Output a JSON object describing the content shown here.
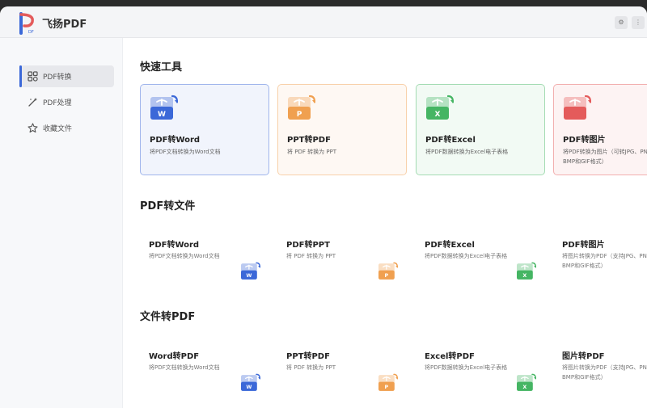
{
  "app": {
    "title": "飞扬PDF"
  },
  "sidebar": {
    "items": [
      {
        "label": "PDF转换",
        "icon": "grid-icon"
      },
      {
        "label": "PDF处理",
        "icon": "magic-wand-icon"
      },
      {
        "label": "收藏文件",
        "icon": "star-icon"
      }
    ]
  },
  "quick": {
    "title": "快速工具",
    "cards": [
      {
        "title": "PDF转Word",
        "desc": "将PDF文档转换为Word文档",
        "color": "#3b68d8",
        "letter": "W"
      },
      {
        "title": "PPT转PDF",
        "desc": "将 PDF 转换为 PPT",
        "color": "#f0a050",
        "letter": "P"
      },
      {
        "title": "PDF转Excel",
        "desc": "将PDF数据转换为Excel电子表格",
        "color": "#45b563",
        "letter": "X"
      },
      {
        "title": "PDF转图片",
        "desc": "将PDF转换为图片（可转JPG、PNG、TIFF、BMP和GIF格式）",
        "color": "#e45b5b",
        "letter": ""
      }
    ]
  },
  "pdf_to_file": {
    "title": "PDF转文件",
    "cards": [
      {
        "title": "PDF转Word",
        "desc": "将PDF文档转换为Word文档",
        "color": "#3b68d8",
        "letter": "W"
      },
      {
        "title": "PDF转PPT",
        "desc": "将 PDF 转换为 PPT",
        "color": "#f0a050",
        "letter": "P"
      },
      {
        "title": "PDF转Excel",
        "desc": "将PDF数据转换为Excel电子表格",
        "color": "#45b563",
        "letter": "X"
      },
      {
        "title": "PDF转图片",
        "desc": "将图片转换为PDF（支持JPG、PNG、TIFF、BMP和GIF格式）",
        "color": "#e45b5b",
        "letter": ""
      }
    ]
  },
  "file_to_pdf": {
    "title": "文件转PDF",
    "cards": [
      {
        "title": "Word转PDF",
        "desc": "将PDF文档转换为Word文档",
        "color": "#3b68d8",
        "letter": "W"
      },
      {
        "title": "PPT转PDF",
        "desc": "将 PDF 转换为 PPT",
        "color": "#f0a050",
        "letter": "P"
      },
      {
        "title": "Excel转PDF",
        "desc": "将PDF数据转换为Excel电子表格",
        "color": "#45b563",
        "letter": "X"
      },
      {
        "title": "图片转PDF",
        "desc": "将图片转换为PDF（支持JPG、PNG、TIFF、BMP和GIF格式）",
        "color": "#e45b5b",
        "letter": ""
      }
    ]
  }
}
